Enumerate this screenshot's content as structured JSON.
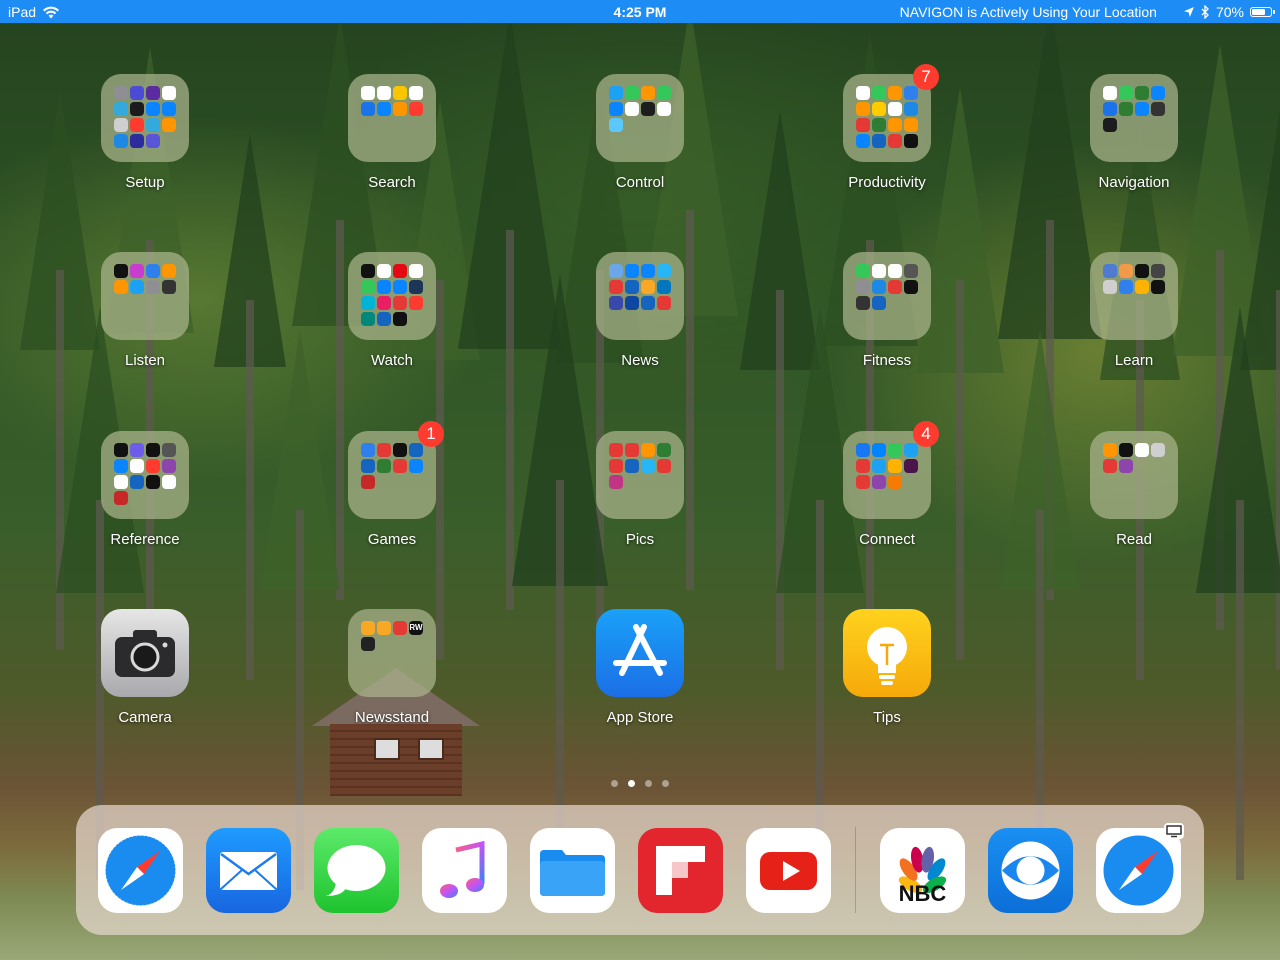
{
  "status_bar": {
    "device": "iPad",
    "time": "4:25 PM",
    "location_text": "NAVIGON is Actively Using Your Location",
    "battery_percent": "70%",
    "battery_level": 0.7,
    "color": "#1e8cf5"
  },
  "folders": [
    {
      "label": "Setup",
      "badge": null,
      "colors": [
        "#8e8e93",
        "#4b4bd6",
        "#5a2ca0",
        "#ffffff",
        "#34aadc",
        "#1c1c1e",
        "#0a84ff",
        "#0a84ff",
        "#cfcfcf",
        "#ff3b30",
        "#34aadc",
        "#ff9500",
        "#1e88e5",
        "#2c2c9c",
        "#5856d6"
      ]
    },
    {
      "label": "Search",
      "badge": null,
      "colors": [
        "#ffffff",
        "#ffffff",
        "#f7c600",
        "#ffffff",
        "#1a73e8",
        "#0a84ff",
        "#ff9500",
        "#ff3b30"
      ]
    },
    {
      "label": "Control",
      "badge": null,
      "colors": [
        "#1da1f2",
        "#34c759",
        "#ff9500",
        "#34c759",
        "#0a84ff",
        "#ffffff",
        "#1d1d1d",
        "#ffffff",
        "#5ac8fa"
      ]
    },
    {
      "label": "Productivity",
      "badge": "7",
      "colors": [
        "#ffffff",
        "#34c759",
        "#ff9500",
        "#2f80ed",
        "#ff9500",
        "#ffcc00",
        "#ffffff",
        "#1e88e5",
        "#e53935",
        "#2e7d32",
        "#ff9500",
        "#ff9500",
        "#0a84ff",
        "#1565c0",
        "#e53935",
        "#111111"
      ]
    },
    {
      "label": "Navigation",
      "badge": null,
      "colors": [
        "#ffffff",
        "#34c759",
        "#2e7d32",
        "#0a84ff",
        "#1a73e8",
        "#2e7d32",
        "#0a84ff",
        "#333333",
        "#1c1c1e"
      ]
    },
    {
      "label": "Listen",
      "badge": null,
      "colors": [
        "#111111",
        "#c83dd0",
        "#2f80ed",
        "#ff9500",
        "#ff9500",
        "#1da1f2",
        "#8e8e93",
        "#333333"
      ]
    },
    {
      "label": "Watch",
      "badge": null,
      "colors": [
        "#111111",
        "#ffffff",
        "#e50914",
        "#ffffff",
        "#34c759",
        "#0a84ff",
        "#0a84ff",
        "#1d3557",
        "#00b4d8",
        "#e91e63",
        "#e53935",
        "#ff3b30",
        "#00897b",
        "#1565c0",
        "#111111"
      ]
    },
    {
      "label": "News",
      "badge": null,
      "colors": [
        "#6aa6e8",
        "#0a84ff",
        "#0a84ff",
        "#29b6f6",
        "#e53935",
        "#1565c0",
        "#f9a825",
        "#0277bd",
        "#3949ab",
        "#0d47a1",
        "#1565c0",
        "#e53935"
      ]
    },
    {
      "label": "Fitness",
      "badge": null,
      "colors": [
        "#34c759",
        "#ffffff",
        "#ffffff",
        "#555555",
        "#8e8e93",
        "#1e88e5",
        "#e53935",
        "#111111",
        "#333333",
        "#1565c0"
      ]
    },
    {
      "label": "Learn",
      "badge": null,
      "colors": [
        "#4e7bd0",
        "#f2994a",
        "#111111",
        "#444444",
        "#cfcfcf",
        "#2f80ed",
        "#ffb300",
        "#111111"
      ]
    },
    {
      "label": "Reference",
      "badge": null,
      "colors": [
        "#111111",
        "#6c5ce7",
        "#111111",
        "#555555",
        "#0a84ff",
        "#ffffff",
        "#ff3b30",
        "#8e44ad",
        "#ffffff",
        "#1565c0",
        "#111111",
        "#ffffff",
        "#c62828"
      ]
    },
    {
      "label": "Games",
      "badge": "1",
      "colors": [
        "#2f80ed",
        "#e53935",
        "#111111",
        "#1565c0",
        "#1565c0",
        "#2e7d32",
        "#e53935",
        "#0a84ff",
        "#c62828"
      ]
    },
    {
      "label": "Pics",
      "badge": null,
      "colors": [
        "#e53935",
        "#e53935",
        "#ff9500",
        "#2e7d32",
        "#e53935",
        "#1565c0",
        "#29b6f6",
        "#e53935",
        "#c13584"
      ]
    },
    {
      "label": "Connect",
      "badge": "4",
      "colors": [
        "#1877f2",
        "#0084ff",
        "#34c759",
        "#1da1f2",
        "#e53935",
        "#1da1f2",
        "#ffb300",
        "#4a154b",
        "#e53935",
        "#8e44ad",
        "#f57c00"
      ]
    },
    {
      "label": "Read",
      "badge": null,
      "colors": [
        "#ff9500",
        "#111111",
        "#ffffff",
        "#cfcfcf",
        "#e53935",
        "#8e44ad"
      ]
    }
  ],
  "apps": [
    {
      "label": "Camera"
    },
    {
      "label": "Newsstand",
      "colors": [
        "#f9a825",
        "#f9a825",
        "#e53935",
        "#111111",
        "#222222"
      ],
      "rw_text": "RW"
    },
    {
      "label": "App Store"
    },
    {
      "label": "Tips"
    }
  ],
  "page_dots": {
    "count": 4,
    "active_index": 1
  },
  "dock": {
    "apps": [
      {
        "name": "Safari",
        "icon": "safari-icon"
      },
      {
        "name": "Mail",
        "icon": "mail-icon"
      },
      {
        "name": "Messages",
        "icon": "messages-icon"
      },
      {
        "name": "Music",
        "icon": "music-icon"
      },
      {
        "name": "Files",
        "icon": "files-icon"
      },
      {
        "name": "Flipboard",
        "icon": "flipboard-icon"
      },
      {
        "name": "YouTube",
        "icon": "youtube-icon"
      },
      {
        "name": "NBC",
        "icon": "nbc-icon",
        "text": "NBC"
      },
      {
        "name": "CBS",
        "icon": "cbs-icon"
      },
      {
        "name": "Safari Handoff",
        "icon": "safari-icon"
      }
    ]
  }
}
